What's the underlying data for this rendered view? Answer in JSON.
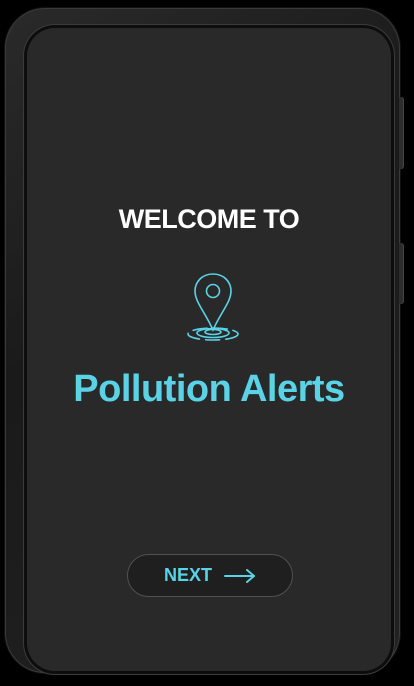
{
  "screen": {
    "welcome_text": "WELCOME TO",
    "app_title": "Pollution Alerts",
    "next_label": "NEXT",
    "icons": {
      "location": "location-pin-icon",
      "arrow": "arrow-right-icon"
    }
  },
  "colors": {
    "accent": "#5ad3e6",
    "screen_background": "#292929",
    "text_primary": "#ffffff"
  }
}
